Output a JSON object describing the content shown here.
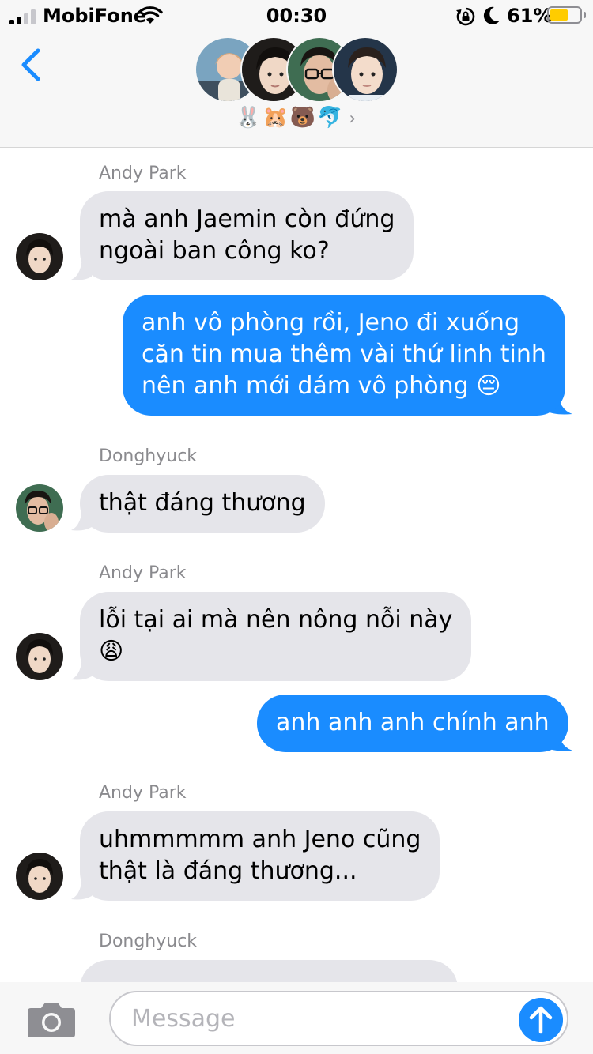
{
  "status_bar": {
    "carrier": "MobiFone",
    "time": "00:30",
    "battery_percent": "61%",
    "battery_level": 0.61,
    "battery_color": "#ffcc00",
    "icons": [
      "signal-icon",
      "wifi-icon",
      "rotation-lock-icon",
      "moon-icon",
      "battery-icon"
    ]
  },
  "header": {
    "back_icon": "chevron-left-icon",
    "member_emojis": "🐰🐹🐻🐬",
    "chevron": "›"
  },
  "messages": [
    {
      "sender": "Andy Park",
      "direction": "incoming",
      "lines": [
        "mà anh Jaemin còn đứng",
        "ngoài ban công ko?"
      ]
    },
    {
      "direction": "outgoing",
      "lines": [
        "anh vô phòng rồi, Jeno đi xuống",
        "căn tin mua thêm vài thứ linh tinh",
        "nên anh mới dám vô phòng 😔"
      ]
    },
    {
      "sender": "Donghyuck",
      "direction": "incoming",
      "lines": [
        "thật đáng thương"
      ]
    },
    {
      "sender": "Andy Park",
      "direction": "incoming",
      "lines": [
        "lỗi tại ai mà nên nông nỗi này",
        "😩"
      ]
    },
    {
      "direction": "outgoing",
      "lines": [
        "anh anh anh chính anh"
      ]
    },
    {
      "sender": "Andy Park",
      "direction": "incoming",
      "lines": [
        "uhmmmmm anh Jeno cũng",
        "thật là đáng thương..."
      ]
    },
    {
      "sender": "Donghyuck",
      "direction": "incoming",
      "lines": [
        "..."
      ]
    }
  ],
  "input_bar": {
    "placeholder": "Message",
    "camera_icon": "camera-icon",
    "send_icon": "arrow-up-icon"
  },
  "colors": {
    "incoming_bubble": "#e5e5ea",
    "outgoing_bubble": "#1a8cff",
    "accent": "#1a8cff",
    "sender_name": "#8a8a8e"
  }
}
